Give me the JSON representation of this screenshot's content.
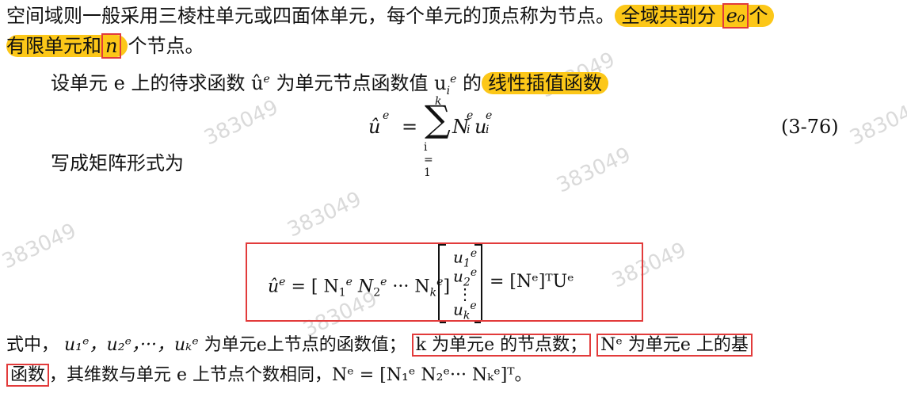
{
  "paragraph": {
    "line1_prefix": "空间域则一般采用三棱柱单元或四面体单元，每个单元的顶点称为节点。",
    "line1_highlight": "全域共剖分",
    "line1_boxed": "e₀",
    "line1_suffix": "个",
    "line2_highlight_prefix": "有限单元和",
    "line2_boxed": "n",
    "line2_suffix": "个节点。",
    "line3_prefix": "设单元 e 上的待求函数 û",
    "line3_mid": "为单元节点函数值 u",
    "line3_suffix": "的",
    "line3_highlight": "线性插值函数",
    "matrix_intro": "写成矩阵形式为"
  },
  "equation_1": {
    "lhs": "û",
    "sum_upper": "k",
    "sum_lower": "i = 1",
    "rhs": "N",
    "rhs2": "u",
    "number": "(3-76)"
  },
  "equation_2": {
    "lhs": "û",
    "row_vector": "= [ N",
    "row_vector_2": "N",
    "row_vector_3": "··· N",
    "column_1": "u",
    "column_2": "u",
    "column_3": "⋮",
    "column_4": "u",
    "rhs": "= [Nᵉ]ᵀUᵉ"
  },
  "notes": {
    "line1_prefix": "式中，",
    "line1_vars": "u₁ᵉ，u₂ᵉ，···，uₖᵉ",
    "line1_mid": "为单元e上节点的函数值；",
    "line1_box1": "k 为单元e 的节点数；",
    "line1_box2": "Nᵉ 为单元e 上的基",
    "line2_box": "函数",
    "line2_suffix": "，其维数与单元 e 上节点个数相同，Nᵉ = [N₁ᵉ N₂ᵉ··· Nₖᵉ]ᵀ。"
  },
  "watermark": {
    "text": "383049"
  }
}
